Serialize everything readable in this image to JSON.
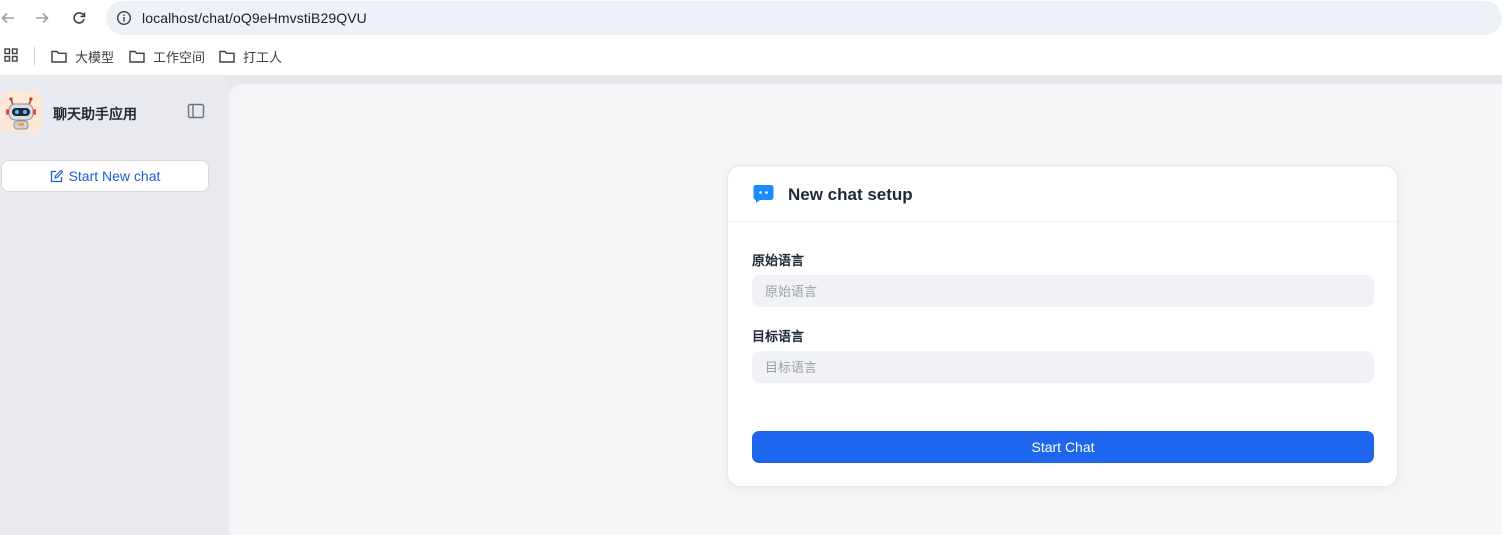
{
  "browser": {
    "url": "localhost/chat/oQ9eHmvstiB29QVU",
    "bookmarks": [
      {
        "label": "大模型",
        "icon": "folder-icon"
      },
      {
        "label": "工作空间",
        "icon": "folder-icon"
      },
      {
        "label": "打工人",
        "icon": "folder-icon"
      }
    ]
  },
  "sidebar": {
    "app_title": "聊天助手应用",
    "new_chat_label": "Start New chat"
  },
  "setup": {
    "title": "New chat setup",
    "source_label": "原始语言",
    "source_placeholder": "原始语言",
    "target_label": "目标语言",
    "target_placeholder": "目标语言",
    "start_label": "Start Chat"
  },
  "colors": {
    "accent": "#1f66ef",
    "link": "#1d5fd6",
    "sidebar_bg": "#e9eaef",
    "main_bg": "#f5f6f8"
  }
}
